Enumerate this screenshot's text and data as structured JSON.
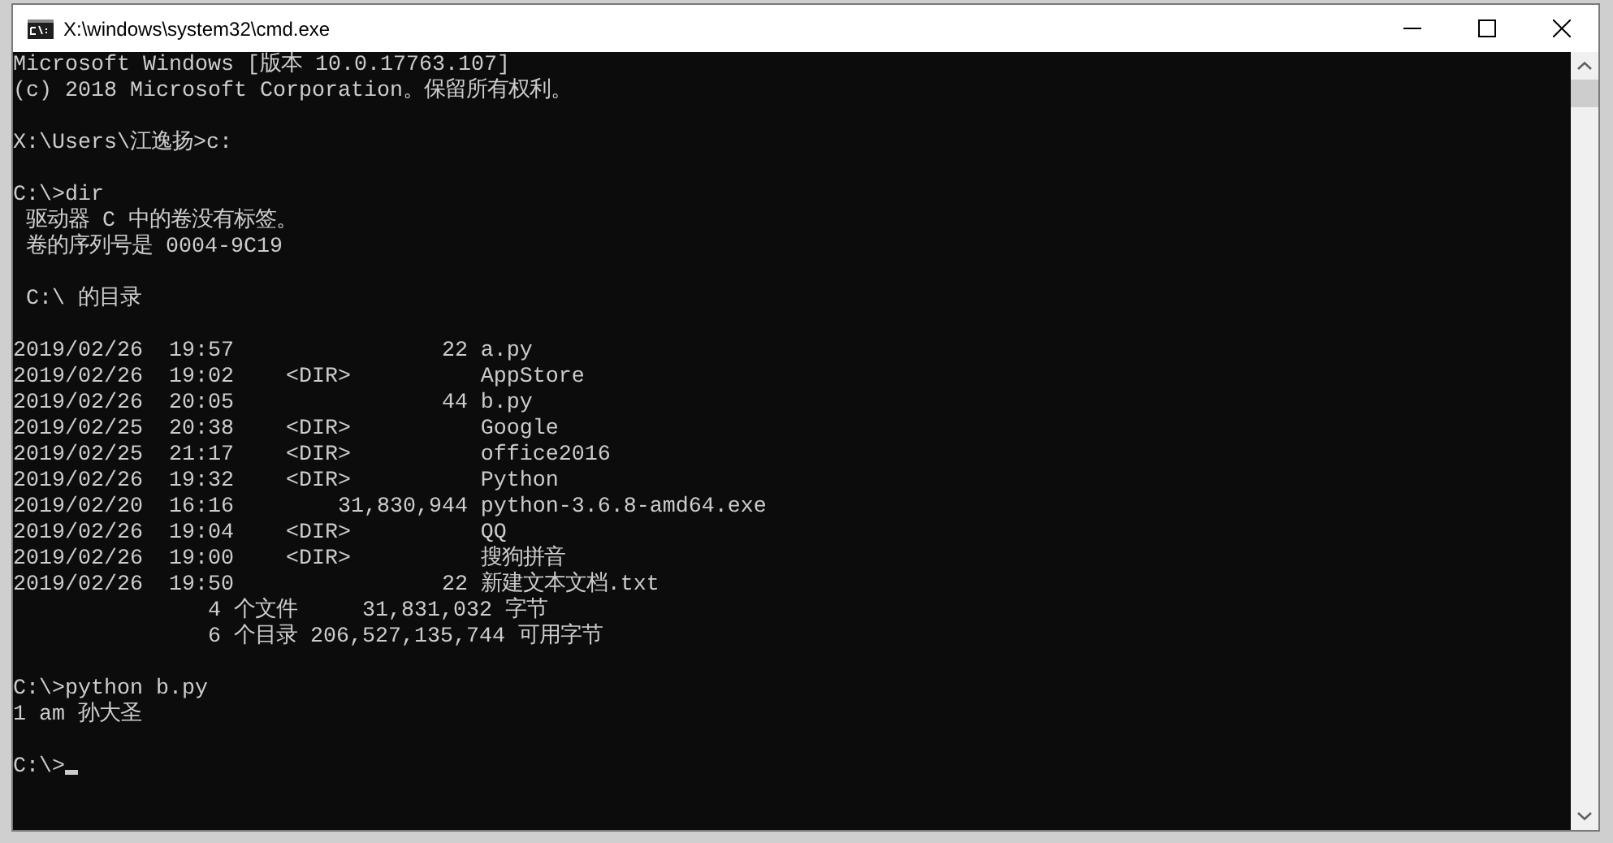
{
  "window": {
    "title": "X:\\windows\\system32\\cmd.exe"
  },
  "console": {
    "blocks": [
      {
        "lines": [
          "Microsoft Windows [版本 10.0.17763.107]",
          "(c) 2018 Microsoft Corporation。保留所有权利。"
        ]
      },
      {
        "lines": [
          "X:\\Users\\江逸扬>c:"
        ]
      },
      {
        "lines": [
          "C:\\>dir",
          " 驱动器 C 中的卷没有标签。",
          " 卷的序列号是 0004-9C19"
        ]
      },
      {
        "lines": [
          " C:\\ 的目录"
        ]
      },
      {
        "lines": [
          "2019/02/26  19:57                22 a.py",
          "2019/02/26  19:02    <DIR>          AppStore",
          "2019/02/26  20:05                44 b.py",
          "2019/02/25  20:38    <DIR>          Google",
          "2019/02/25  21:17    <DIR>          office2016",
          "2019/02/26  19:32    <DIR>          Python",
          "2019/02/20  16:16        31,830,944 python-3.6.8-amd64.exe",
          "2019/02/26  19:04    <DIR>          QQ",
          "2019/02/26  19:00    <DIR>          搜狗拼音",
          "2019/02/26  19:50                22 新建文本文档.txt",
          "               4 个文件     31,831,032 字节",
          "               6 个目录 206,527,135,744 可用字节"
        ]
      },
      {
        "lines": [
          "C:\\>python b.py",
          "1 am 孙大圣"
        ]
      },
      {
        "lines": [
          "C:\\>"
        ]
      }
    ],
    "cursor_visible": true
  }
}
